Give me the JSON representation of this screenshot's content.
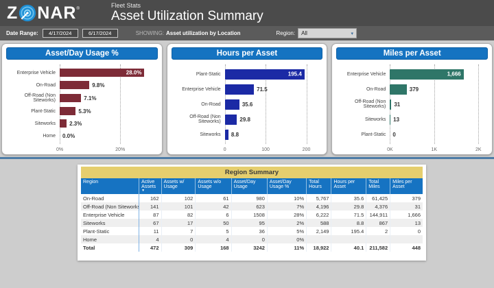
{
  "header": {
    "logo_z": "Z",
    "logo_rest": "NAR",
    "logo_reg": "®",
    "app_subtitle": "Fleet Stats",
    "title": "Asset Utilization Summary"
  },
  "filter_bar": {
    "date_range_label": "Date Range:",
    "date_start": "4/17/2024",
    "date_end": "6/17/2024",
    "showing_label": "SHOWING:",
    "showing_value": "Asset utilization by Location",
    "region_label": "Region:",
    "region_value": "All",
    "region_chevron": "▾"
  },
  "colors": {
    "header_bg": "#4B4B4B",
    "filterbar_bg": "#5B5B5B",
    "page_bg": "#CDCDCD",
    "chart_title_bg": "#1573C1",
    "table_header_bg": "#1673C2",
    "table_title_bg": "#E5CE6E",
    "divider": "#4D7CA6",
    "row_alt": "#EFEFEF",
    "usage_bar": "#7D2B37",
    "hours_bar": "#1B2AA5",
    "miles_bar": "#2F7668"
  },
  "chart_data": [
    {
      "type": "bar",
      "orientation": "horizontal",
      "title": "Asset/Day Usage %",
      "categories": [
        "Enterprise Vehicle",
        "On-Road",
        "Off-Road (Non Siteworks)",
        "Plant-Static",
        "Siteworks",
        "Home"
      ],
      "values": [
        28.0,
        9.8,
        7.1,
        5.3,
        2.3,
        0.0
      ],
      "value_labels": [
        "28.0%",
        "9.8%",
        "7.1%",
        "5.3%",
        "2.3%",
        "0.0%"
      ],
      "xticks": [
        {
          "label": "0%",
          "value": 0
        },
        {
          "label": "20%",
          "value": 20
        }
      ],
      "xlim": [
        0,
        31
      ],
      "grid": true,
      "bar_color": "#7D2B37"
    },
    {
      "type": "bar",
      "orientation": "horizontal",
      "title": "Hours per Asset",
      "categories": [
        "Plant-Static",
        "Enterprise Vehicle",
        "On-Road",
        "Off-Road (Non Siteworks)",
        "Siteworks"
      ],
      "values": [
        195.4,
        71.5,
        35.6,
        29.8,
        8.8
      ],
      "value_labels": [
        "195.4",
        "71.5",
        "35.6",
        "29.8",
        "8.8"
      ],
      "xticks": [
        {
          "label": "0",
          "value": 0
        },
        {
          "label": "100",
          "value": 100
        },
        {
          "label": "200",
          "value": 200
        }
      ],
      "xlim": [
        0,
        230
      ],
      "grid": true,
      "bar_color": "#1B2AA5"
    },
    {
      "type": "bar",
      "orientation": "horizontal",
      "title": "Miles per Asset",
      "categories": [
        "Enterprise Vehicle",
        "On-Road",
        "Off-Road (Non Siteworks)",
        "Siteworks",
        "Plant-Static"
      ],
      "values": [
        1666,
        379,
        31,
        13,
        0
      ],
      "value_labels": [
        "1,666",
        "379",
        "31",
        "13",
        "0"
      ],
      "xticks": [
        {
          "label": "0K",
          "value": 0
        },
        {
          "label": "1K",
          "value": 1000
        },
        {
          "label": "2K",
          "value": 2000
        }
      ],
      "xlim": [
        0,
        2120
      ],
      "grid": true,
      "bar_color": "#2F7668"
    }
  ],
  "table": {
    "title": "Region Summary",
    "columns": [
      "Region",
      "Active Assets",
      "Assets w/ Usage",
      "Assets w/o Usage",
      "Asset/Day Usage",
      "Asset/Day Usage %",
      "Total Hours",
      "Hours per Asset",
      "Total Miles",
      "Miles per Asset"
    ],
    "sort_column_index": 1,
    "sort_indicator": "▼",
    "rows": [
      [
        "On-Road",
        "162",
        "102",
        "61",
        "980",
        "10%",
        "5,767",
        "35.6",
        "61,425",
        "379"
      ],
      [
        "Off-Road (Non Siteworks)",
        "141",
        "101",
        "42",
        "623",
        "7%",
        "4,196",
        "29.8",
        "4,376",
        "31"
      ],
      [
        "Enterprise Vehicle",
        "87",
        "82",
        "6",
        "1508",
        "28%",
        "6,222",
        "71.5",
        "144,911",
        "1,666"
      ],
      [
        "Siteworks",
        "67",
        "17",
        "50",
        "95",
        "2%",
        "588",
        "8.8",
        "867",
        "13"
      ],
      [
        "Plant-Static",
        "11",
        "7",
        "5",
        "36",
        "5%",
        "2,149",
        "195.4",
        "2",
        "0"
      ],
      [
        "Home",
        "4",
        "0",
        "4",
        "0",
        "0%",
        "",
        "",
        "",
        ""
      ]
    ],
    "total_row": [
      "Total",
      "472",
      "309",
      "168",
      "3242",
      "11%",
      "18,922",
      "40.1",
      "211,582",
      "448"
    ]
  }
}
